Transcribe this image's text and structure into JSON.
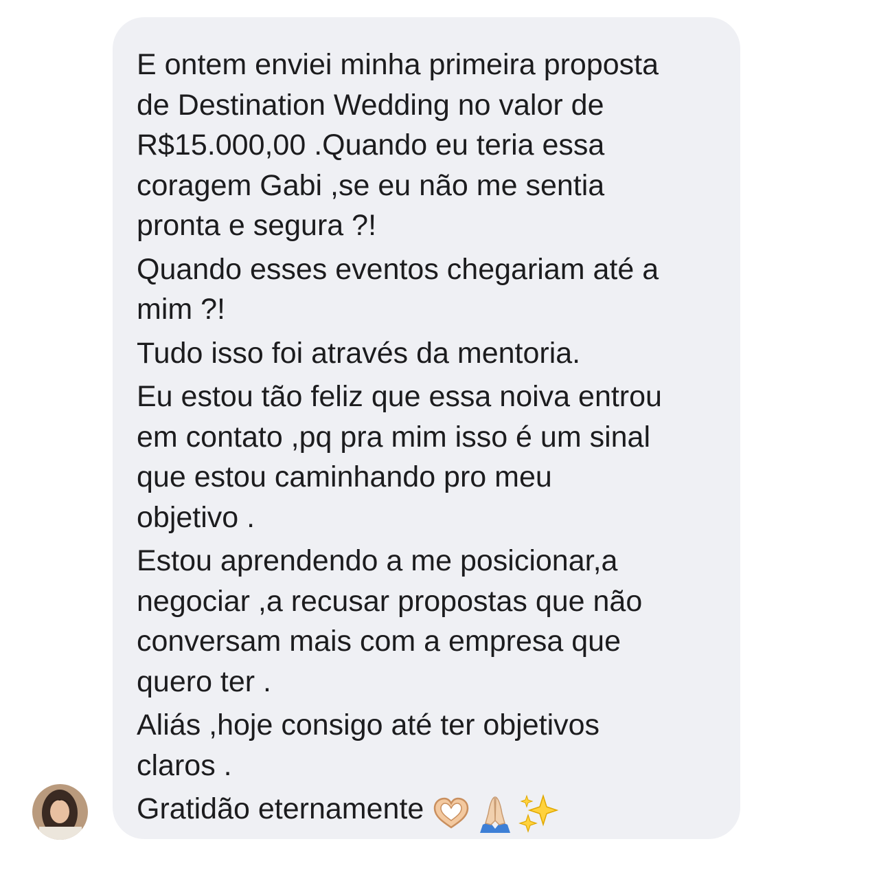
{
  "message": {
    "paragraphs": [
      "E ontem enviei minha primeira proposta\nde Destination Wedding no valor de\nR$15.000,00 .Quando eu teria essa\ncoragem Gabi ,se eu não me sentia\npronta e segura ?!",
      "Quando esses eventos chegariam até a\nmim ?!",
      "Tudo isso foi através da mentoria.",
      "Eu estou tão feliz que essa noiva entrou\nem contato ,pq pra mim isso é um sinal\nque estou caminhando pro meu\nobjetivo .",
      "Estou aprendendo a me posicionar,a\nnegociar ,a recusar propostas que não\nconversam mais com a empresa que\nquero ter .",
      "Aliás ,hoje consigo até ter objetivos\nclaros ."
    ],
    "last_line": "Gratidão eternamente",
    "emojis": [
      "heart-hands-icon",
      "praying-hands-icon",
      "sparkles-icon"
    ]
  },
  "colors": {
    "bubble": "#eff0f4",
    "text": "#1c1c1e"
  }
}
